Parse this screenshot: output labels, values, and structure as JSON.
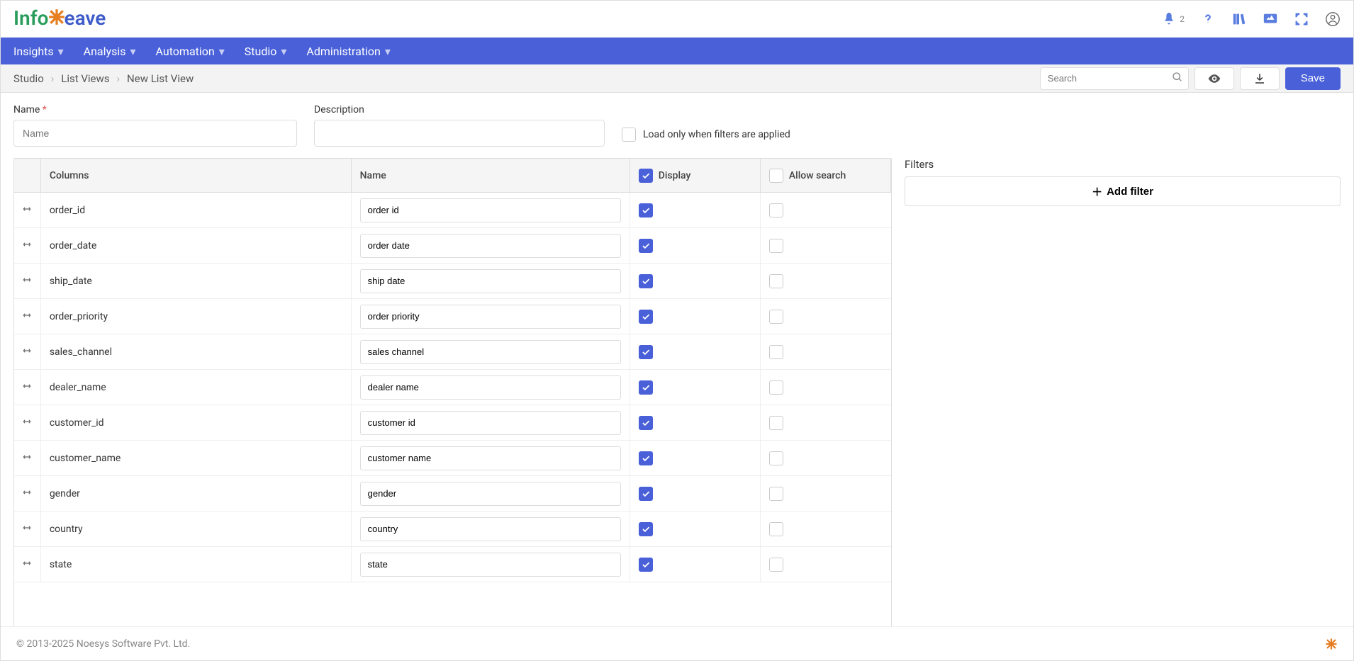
{
  "header": {
    "logo_part1": "Info",
    "logo_part2": "eave",
    "notification_count": "2"
  },
  "nav": {
    "items": [
      "Insights",
      "Analysis",
      "Automation",
      "Studio",
      "Administration"
    ]
  },
  "breadcrumb": {
    "items": [
      "Studio",
      "List Views",
      "New List View"
    ]
  },
  "actions": {
    "search_placeholder": "Search",
    "save_label": "Save"
  },
  "form": {
    "name_label": "Name",
    "name_placeholder": "Name",
    "desc_label": "Description",
    "load_filter_label": "Load only when filters are applied"
  },
  "filters": {
    "title": "Filters",
    "add_label": "Add filter"
  },
  "table": {
    "headers": {
      "columns": "Columns",
      "name": "Name",
      "display": "Display",
      "allow_search": "Allow search"
    },
    "rows": [
      {
        "column": "order_id",
        "name": "order id",
        "display": true,
        "search": false
      },
      {
        "column": "order_date",
        "name": "order date",
        "display": true,
        "search": false
      },
      {
        "column": "ship_date",
        "name": "ship date",
        "display": true,
        "search": false
      },
      {
        "column": "order_priority",
        "name": "order priority",
        "display": true,
        "search": false
      },
      {
        "column": "sales_channel",
        "name": "sales channel",
        "display": true,
        "search": false
      },
      {
        "column": "dealer_name",
        "name": "dealer name",
        "display": true,
        "search": false
      },
      {
        "column": "customer_id",
        "name": "customer id",
        "display": true,
        "search": false
      },
      {
        "column": "customer_name",
        "name": "customer name",
        "display": true,
        "search": false
      },
      {
        "column": "gender",
        "name": "gender",
        "display": true,
        "search": false
      },
      {
        "column": "country",
        "name": "country",
        "display": true,
        "search": false
      },
      {
        "column": "state",
        "name": "state",
        "display": true,
        "search": false
      }
    ]
  },
  "footer": {
    "copyright": "© 2013-2025 Noesys Software Pvt. Ltd."
  }
}
